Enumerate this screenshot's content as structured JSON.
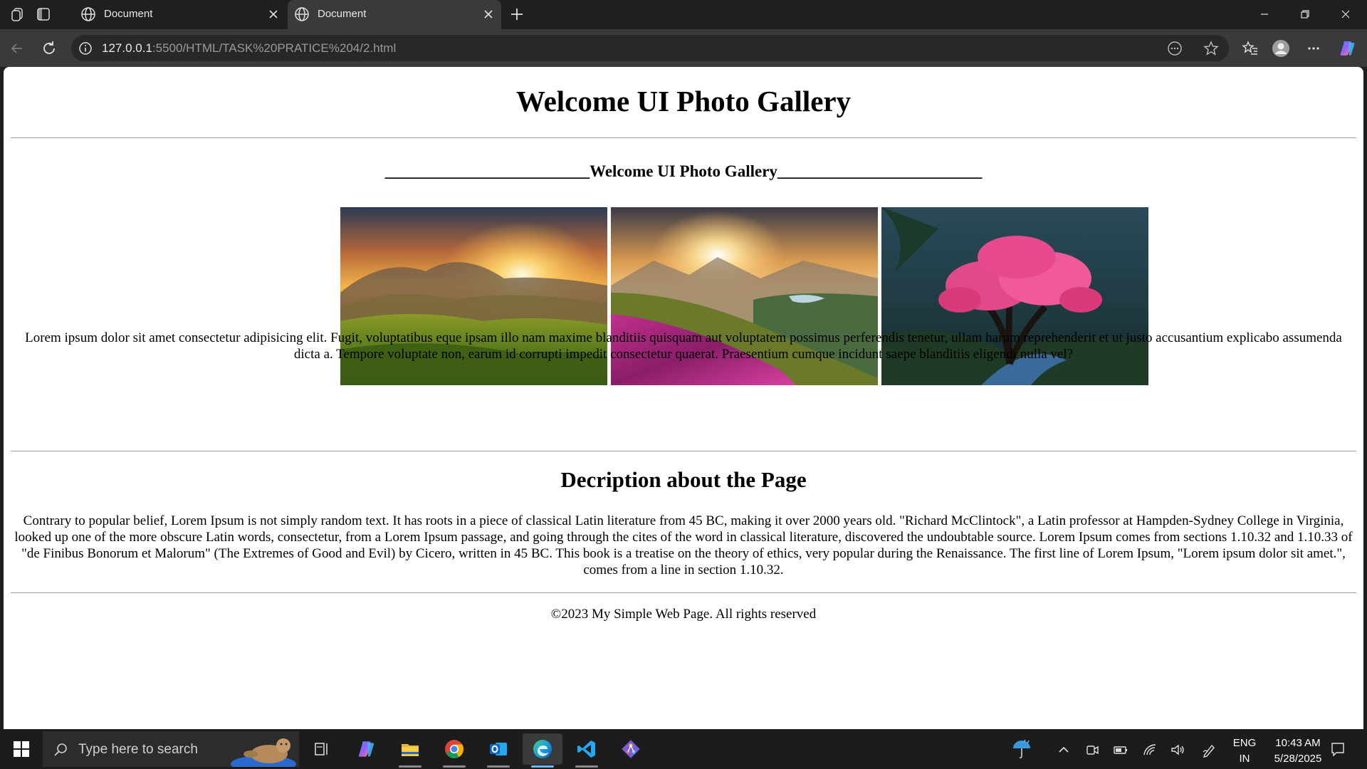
{
  "browser": {
    "tabs": [
      {
        "title": "Document",
        "active": false
      },
      {
        "title": "Document",
        "active": true
      }
    ],
    "address": {
      "host": "127.0.0.1",
      "path": ":5500/HTML/TASK%20PRATICE%204/2.html"
    }
  },
  "page": {
    "heading": "Welcome UI Photo Gallery",
    "subheading": "_________________________Welcome UI Photo Gallery_________________________",
    "gallery": [
      {
        "name": "sunset-grass-hills-photo"
      },
      {
        "name": "pink-flower-valley-photo"
      },
      {
        "name": "pink-blossom-tree-photo"
      }
    ],
    "intro_paragraph": "Lorem ipsum dolor sit amet consectetur adipisicing elit. Fugit, voluptatibus eque ipsam illo nam maxime blanditiis quisquam aut voluptatem possimus perferendis tenetur, ullam harum reprehenderit et ut justo accusantium explicabo assumenda dicta a. Tempore voluptate non, earum id corrupti impedit consectetur quaerat. Praesentium cumque incidunt saepe blanditiis eligendi nulla vel?",
    "description_heading": "Decription about the Page",
    "description_paragraph": "Contrary to popular belief, Lorem Ipsum is not simply random text. It has roots in a piece of classical Latin literature from 45 BC, making it over 2000 years old. \"Richard McClintock\", a Latin professor at Hampden-Sydney College in Virginia, looked up one of the more obscure Latin words, consectetur, from a Lorem Ipsum passage, and going through the cites of the word in classical literature, discovered the undoubtable source. Lorem Ipsum comes from sections 1.10.32 and 1.10.33 of \"de Finibus Bonorum et Malorum\" (The Extremes of Good and Evil) by Cicero, written in 45 BC. This book is a treatise on the theory of ethics, very popular during the Renaissance. The first line of Lorem Ipsum, \"Lorem ipsum dolor sit amet.\", comes from a line in section 1.10.32.",
    "footer": "©2023 My Simple Web Page. All rights reserved"
  },
  "taskbar": {
    "search_placeholder": "Type here to search",
    "language": "ENG",
    "region": "IN",
    "time": "10:43 AM",
    "date": "5/28/2025",
    "apps": [
      "task-view",
      "copilot",
      "file-explorer",
      "chrome",
      "outlook",
      "edge",
      "vscode",
      "git"
    ]
  },
  "colors": {
    "titlebar": "#1f1f1f",
    "toolbar": "#3a3a3a",
    "omnibox": "#282828",
    "page_bg": "#ffffff",
    "taskbar": "#1c1c1c",
    "accent": "#6cb8f0"
  }
}
